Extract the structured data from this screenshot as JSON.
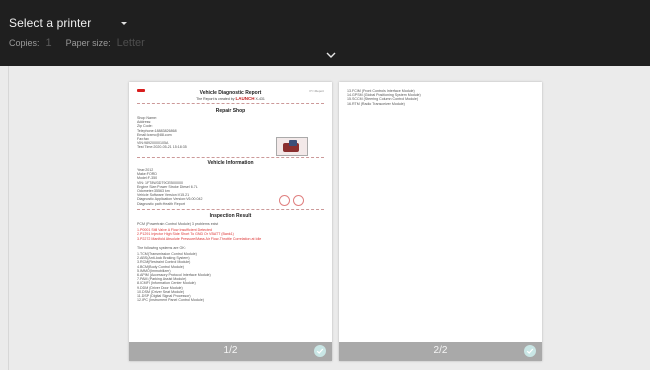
{
  "header": {
    "printer_label": "Select a printer",
    "copies_label": "Copies:",
    "copies_value": "1",
    "paper_size_label": "Paper size:",
    "paper_size_value": "Letter"
  },
  "doc": {
    "top_right": "P>>Report",
    "title": "Vehicle Diagnostic Report",
    "subtitle_prefix": "The Report is created by",
    "subtitle_brand": "LAUNCH",
    "subtitle_suffix": "X-431",
    "repair_shop_heading": "Repair Shop",
    "shop_lines": [
      "Shop Name:",
      "Address:",
      "Zip Code:",
      "Telephone:18883826868",
      "Email:lcxmc@88.com",
      "Fax:fax",
      "VIN:98920000105A",
      "Test Time:2020-05-21 15:18:35"
    ],
    "vehicle_heading": "Vehicle Information",
    "vehicle_lines": [
      "Year:2012",
      "Make:FORD",
      "Model:F-350",
      "VIN: 1FT8W3DT9CEB00000",
      "Engine Size:Power Stroke Diesel 6.7L",
      "Odometer:35563 km",
      "Vehicle Software Version:V15.21",
      "Diagnostic Application Version:V6.00.042",
      "Diagnostic path:Health Report"
    ],
    "inspection_heading": "Inspection Result",
    "pcm_line": "PCM (Powertrain Control Module) 3 problems exist",
    "problems": [
      "1.P0001 Still Valve A Flow Insufficient Detected",
      "2.P1291 Injector High Side Short To GND Or VBATT (Bank1)",
      "3.P2272 Manifold Absolute Pressure/Mass Air Flow-Throttle Correlation at Idle"
    ],
    "ok_line": "The following systems are OK:",
    "ok_systems": [
      "1.TCM(Transmission Control Module)",
      "2.ABS(Anti-lock Braking System)",
      "3.RCM(Restraint Control Module)",
      "4.BCM(Body Control Module)",
      "5.IMMO(Immobilizer)",
      "6.APIM (Accessory Protocol Interface Module)",
      "7.PAM (Parking Assist Module)",
      "8.ICMFI (Information Center Module)",
      "9.DDM (Driver Door Module)",
      "10.DSM (Driver Seat Module)",
      "11.DSP (Digital Signal Processor)",
      "12.IPC (Instrument Panel Control Module)"
    ],
    "page2_lines": [
      "13.FCIM (Front Controls Interface Module)",
      "14.GPSM (Global Positioning System Module)",
      "15.SCCM (Steering Column Control Module)",
      "16.RTM (Radio Transceiver Module)"
    ]
  },
  "pages": [
    {
      "label": "1/2"
    },
    {
      "label": "2/2"
    }
  ],
  "icons": {
    "caret": "dropdown-caret-icon",
    "chevron": "chevron-down-icon",
    "check": "check-circle-icon"
  }
}
